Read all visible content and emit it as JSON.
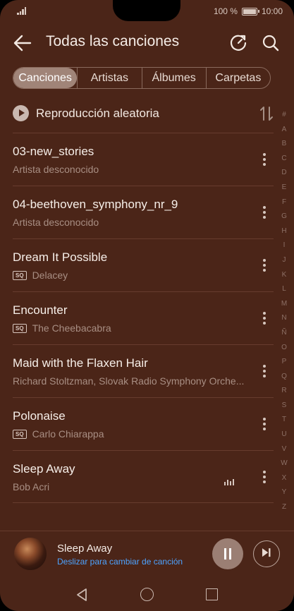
{
  "status_bar": {
    "battery": "100 %",
    "time": "10:00"
  },
  "header": {
    "title": "Todas las canciones"
  },
  "tabs": [
    {
      "label": "Canciones",
      "active": true
    },
    {
      "label": "Artistas",
      "active": false
    },
    {
      "label": "Álbumes",
      "active": false
    },
    {
      "label": "Carpetas",
      "active": false
    }
  ],
  "shuffle": {
    "label": "Reproducción aleatoria"
  },
  "songs": [
    {
      "title": "03-new_stories",
      "subtitle": "Artista desconocido",
      "sq": false,
      "playing": false
    },
    {
      "title": "04-beethoven_symphony_nr_9",
      "subtitle": "Artista desconocido",
      "sq": false,
      "playing": false
    },
    {
      "title": "Dream It Possible",
      "subtitle": "Delacey",
      "sq": true,
      "playing": false
    },
    {
      "title": "Encounter",
      "subtitle": "The Cheebacabra",
      "sq": true,
      "playing": false
    },
    {
      "title": "Maid with the Flaxen Hair",
      "subtitle": "Richard Stoltzman, Slovak Radio Symphony Orche...",
      "sq": false,
      "playing": false
    },
    {
      "title": "Polonaise",
      "subtitle": "Carlo Chiarappa",
      "sq": true,
      "playing": false
    },
    {
      "title": "Sleep Away",
      "subtitle": "Bob Acri",
      "sq": false,
      "playing": true
    }
  ],
  "sq_badge": "SQ",
  "alphabet": [
    "#",
    "A",
    "B",
    "C",
    "D",
    "E",
    "F",
    "G",
    "H",
    "I",
    "J",
    "K",
    "L",
    "M",
    "N",
    "Ñ",
    "O",
    "P",
    "Q",
    "R",
    "S",
    "T",
    "U",
    "V",
    "W",
    "X",
    "Y",
    "Z"
  ],
  "now_playing": {
    "title": "Sleep Away",
    "hint": "Deslizar para cambiar de canción"
  },
  "colors": {
    "background": "#4b2518",
    "accent_link": "#4da3ff",
    "tab_active": "#a08478"
  }
}
